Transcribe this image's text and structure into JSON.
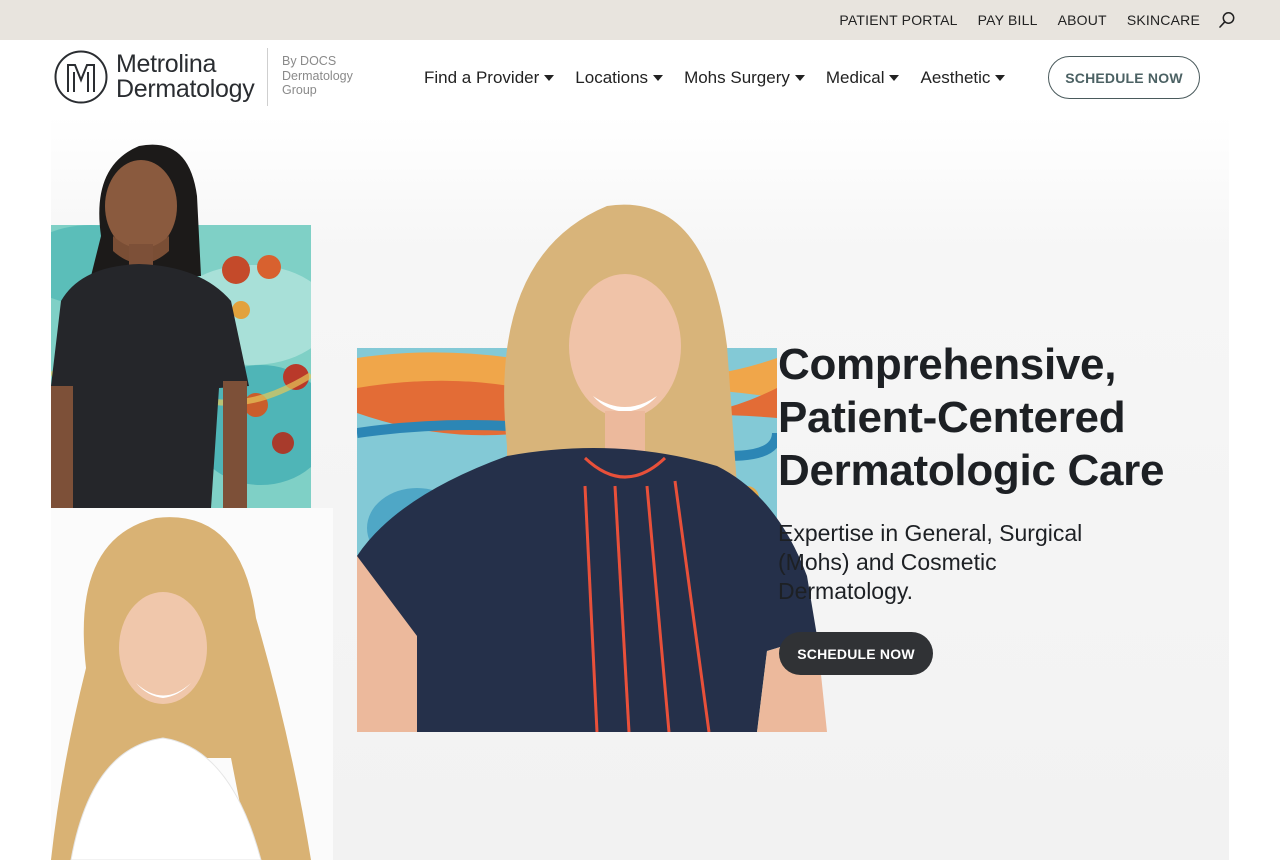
{
  "utility_bar": {
    "links": [
      "PATIENT PORTAL",
      "PAY BILL",
      "ABOUT",
      "SKINCARE"
    ],
    "search_icon": "search-icon"
  },
  "header": {
    "logo": {
      "line1": "Metrolina",
      "line2": "Dermatology",
      "sub": "By DOCS Dermatology Group"
    },
    "nav": [
      {
        "label": "Find a Provider",
        "icon": "caret-down-icon"
      },
      {
        "label": "Locations",
        "icon": "caret-down-icon"
      },
      {
        "label": "Mohs Surgery",
        "icon": "caret-down-icon"
      },
      {
        "label": "Medical",
        "icon": "caret-down-icon"
      },
      {
        "label": "Aesthetic",
        "icon": "caret-down-icon"
      }
    ],
    "cta": "SCHEDULE NOW"
  },
  "hero": {
    "title_lines": [
      "Comprehensive,",
      "Patient-Centered",
      "Dermatologic Care"
    ],
    "subtitle": "Expertise in General, Surgical (Mohs) and Cosmetic Dermatology.",
    "cta": "SCHEDULE NOW"
  },
  "colors": {
    "utility_bg": "#e8e4de",
    "text_dark": "#1d2024",
    "cta_dark": "#303235",
    "cta_outline_text": "#4b6163"
  }
}
